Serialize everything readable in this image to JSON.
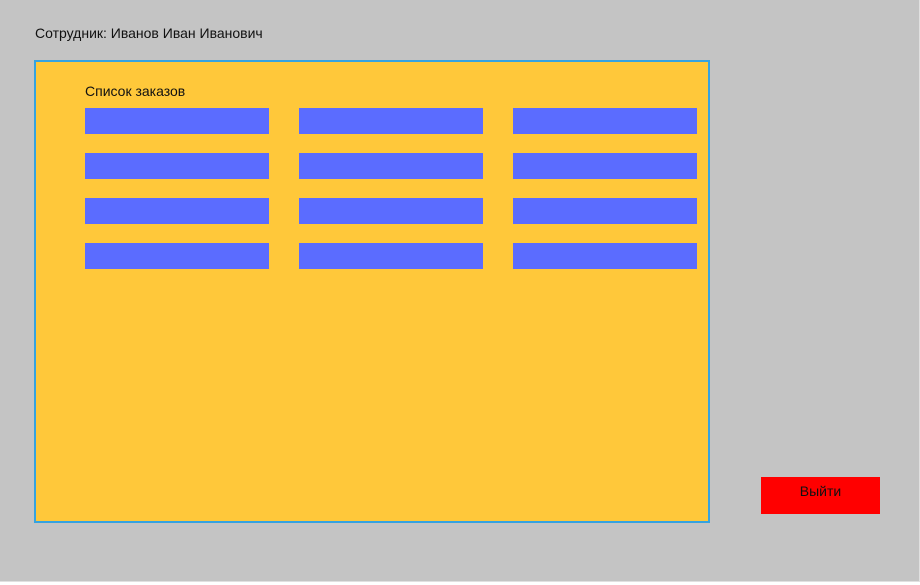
{
  "header": {
    "employee_text": "Сотрудник: Иванов Иван Иванович"
  },
  "orders": {
    "title": "Список заказов",
    "rows": 4,
    "columns": 3,
    "items": [
      "",
      "",
      "",
      "",
      "",
      "",
      "",
      "",
      "",
      "",
      "",
      ""
    ]
  },
  "actions": {
    "logout_label": "Выйти"
  },
  "colors": {
    "background": "#c4c4c4",
    "panel": "#ffc83a",
    "panel_border": "#36a3e0",
    "order_item": "#5b6cff",
    "logout": "#ff0000"
  }
}
